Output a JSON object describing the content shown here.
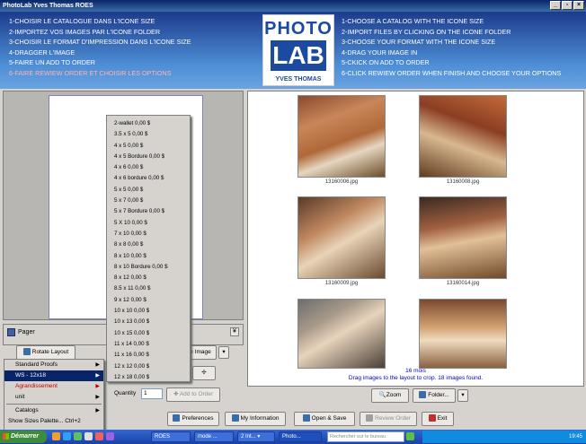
{
  "window": {
    "title": "PhotoLab Yves Thomas ROES"
  },
  "header": {
    "instructions_fr": [
      "1-CHOISIR LE CATALOGUE  DANS L'ICONE SIZE",
      "2-IMPORTEZ VOS IMAGES PAR L'ICONE FOLDER",
      "3-CHOISIR LE FORMAT D'IMPRESSION DANS L'ICONE SIZE",
      "4-DRAGGER L'IMAGE",
      "5-FAIRE UN ADD TO ORDER",
      "6-FAIRE REWIEW ORDER ET CHOISIR LES OPTIONS"
    ],
    "instructions_en": [
      "1-CHOOSE A CATALOG WITH THE ICONE SIZE",
      "2-IMPORT FILES BY CLICKING ON THE ICONE FOLDER",
      "3-CHOOSE YOUR FORMAT WITH THE ICONE SIZE",
      "4-DRAG YOUR IMAGE IN",
      "5-CKICK ON ADD TO ORDER",
      "6-CLICK REWIEW ORDER WHEN FINISH AND CHOOSE YOUR OPTIONS"
    ],
    "logo": {
      "line1": "PHOTO",
      "line2": "LAB",
      "line3": "YVES THOMAS"
    }
  },
  "thumbnails": [
    {
      "filename": "13160006.jpg"
    },
    {
      "filename": "13160008.jpg"
    },
    {
      "filename": "13160009.jpg"
    },
    {
      "filename": "13160014.jpg"
    },
    {
      "filename": ""
    },
    {
      "filename": ""
    }
  ],
  "status": {
    "line1": "16 mois",
    "line2": "Drag images to the layout to crop. 18 images found."
  },
  "pager": {
    "label": "Pager"
  },
  "size_menu": [
    "2-wallet  0,00 $",
    "3.5 x 5  0,00 $",
    "4 x 5  0,00 $",
    "4 x 5 Bordure  0,00 $",
    "4 x 6  0,00 $",
    "4 x 6 bordure  0,00 $",
    "5 x 5  0,00 $",
    "5 x 7  0,00 $",
    "5 x 7 Bordure  0,00 $",
    "5 X 10  0,00 $",
    "7 x 10  0,00 $",
    "8 x 8  0,00 $",
    "8 x 10  0,00 $",
    "8 x 10 Bordure  0,00 $",
    "8 x 12  0,00 $",
    "8.5 x 11  0,00 $",
    "9 x 12  0,00 $",
    "10 x 10  0,00 $",
    "10 x 13  0,00 $",
    "10 x 15  0,00 $",
    "11 x 14  0,00 $",
    "11 x 16  0,00 $",
    "12 x 12  0,00 $",
    "12 x 18  0,00 $"
  ],
  "context_menu": {
    "standard_proofs": "Standard Proofs",
    "ws": "WS - 12x18",
    "agrandissement": "Agrandissement",
    "unit": "unit",
    "catalogs": "Catalogs",
    "show_sizes": "Show Sizes Palette...   Ctrl+2"
  },
  "buttons": {
    "rotate_layout": "Rotate Layout",
    "image": "e Image",
    "quantity_label": "Quantity",
    "quantity_value": "1",
    "add_to_order": "Add to Order",
    "zoom": "Zoom",
    "folder": "Folder...",
    "preferences": "Preferences",
    "my_information": "My Information",
    "open_save": "Open & Save",
    "review_order": "Review Order",
    "exit": "Exit"
  },
  "taskbar": {
    "start": "Démarrer",
    "items": [
      "ROES",
      "mode ...",
      "2 Int... ▾",
      "Photo..."
    ],
    "search_placeholder": "Rechercher sur le bureau",
    "clock": "19:45"
  }
}
